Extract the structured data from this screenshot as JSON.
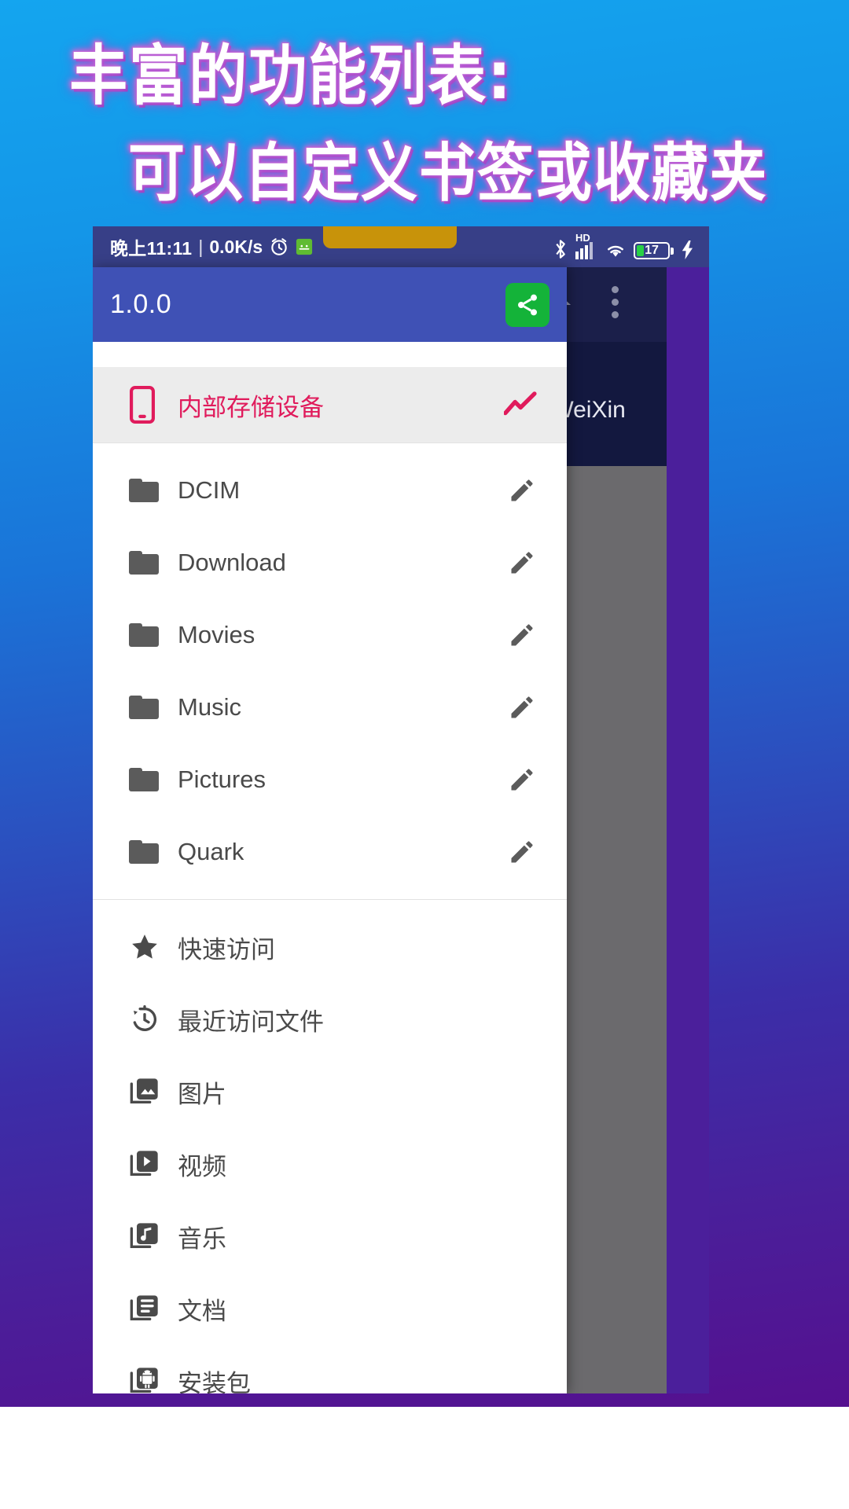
{
  "promo": {
    "headline_line1": "丰富的功能列表:",
    "headline_line2": "可以自定义书签或收藏夹",
    "bg_color_top": "#14a5ef",
    "bg_color_bottom": "#55108f",
    "headline_text_color": "#ffffff",
    "headline_glow_color": "#b465d6"
  },
  "status_bar": {
    "time": "晚上11:11",
    "separator": "|",
    "net_speed": "0.0K/s",
    "alarm_icon": "alarm-clock-icon",
    "android_icon": "android-notification-icon",
    "bluetooth_icon": "bluetooth-icon",
    "hd_label": "HD",
    "signal_icon": "signal-bars-icon",
    "wifi_icon": "wifi-icon",
    "battery_percent": "17",
    "charging_icon": "charging-bolt-icon",
    "background_color": "#373f87"
  },
  "behind_activity": {
    "home_icon": "home-icon",
    "overflow_icon": "overflow-menu-icon",
    "path_text": "s/WeiXin",
    "bar_color": "#1b1f4a",
    "scrim_color": "#6b6a6d"
  },
  "drawer": {
    "header": {
      "version": "1.0.0",
      "share_icon": "share-icon",
      "share_button_color": "#14b339",
      "background_color": "#3f51b5"
    },
    "storage_item": {
      "label": "内部存储设备",
      "icon": "phone-storage-icon",
      "action_icon": "chart-trending-icon",
      "accent_color": "#e01b5c",
      "background_color": "#ececec"
    },
    "folders": [
      {
        "label": "DCIM",
        "icon": "folder-icon",
        "action_icon": "edit-pencil-icon"
      },
      {
        "label": "Download",
        "icon": "folder-icon",
        "action_icon": "edit-pencil-icon"
      },
      {
        "label": "Movies",
        "icon": "folder-icon",
        "action_icon": "edit-pencil-icon"
      },
      {
        "label": "Music",
        "icon": "folder-icon",
        "action_icon": "edit-pencil-icon"
      },
      {
        "label": "Pictures",
        "icon": "folder-icon",
        "action_icon": "edit-pencil-icon"
      },
      {
        "label": "Quark",
        "icon": "folder-icon",
        "action_icon": "edit-pencil-icon"
      }
    ],
    "shortcuts": [
      {
        "label": "快速访问",
        "icon": "star-icon"
      },
      {
        "label": "最近访问文件",
        "icon": "history-icon"
      },
      {
        "label": "图片",
        "icon": "photo-library-icon"
      },
      {
        "label": "视频",
        "icon": "video-library-icon"
      },
      {
        "label": "音乐",
        "icon": "music-library-icon"
      },
      {
        "label": "文档",
        "icon": "document-library-icon"
      },
      {
        "label": "安装包",
        "icon": "android-package-icon"
      }
    ]
  }
}
